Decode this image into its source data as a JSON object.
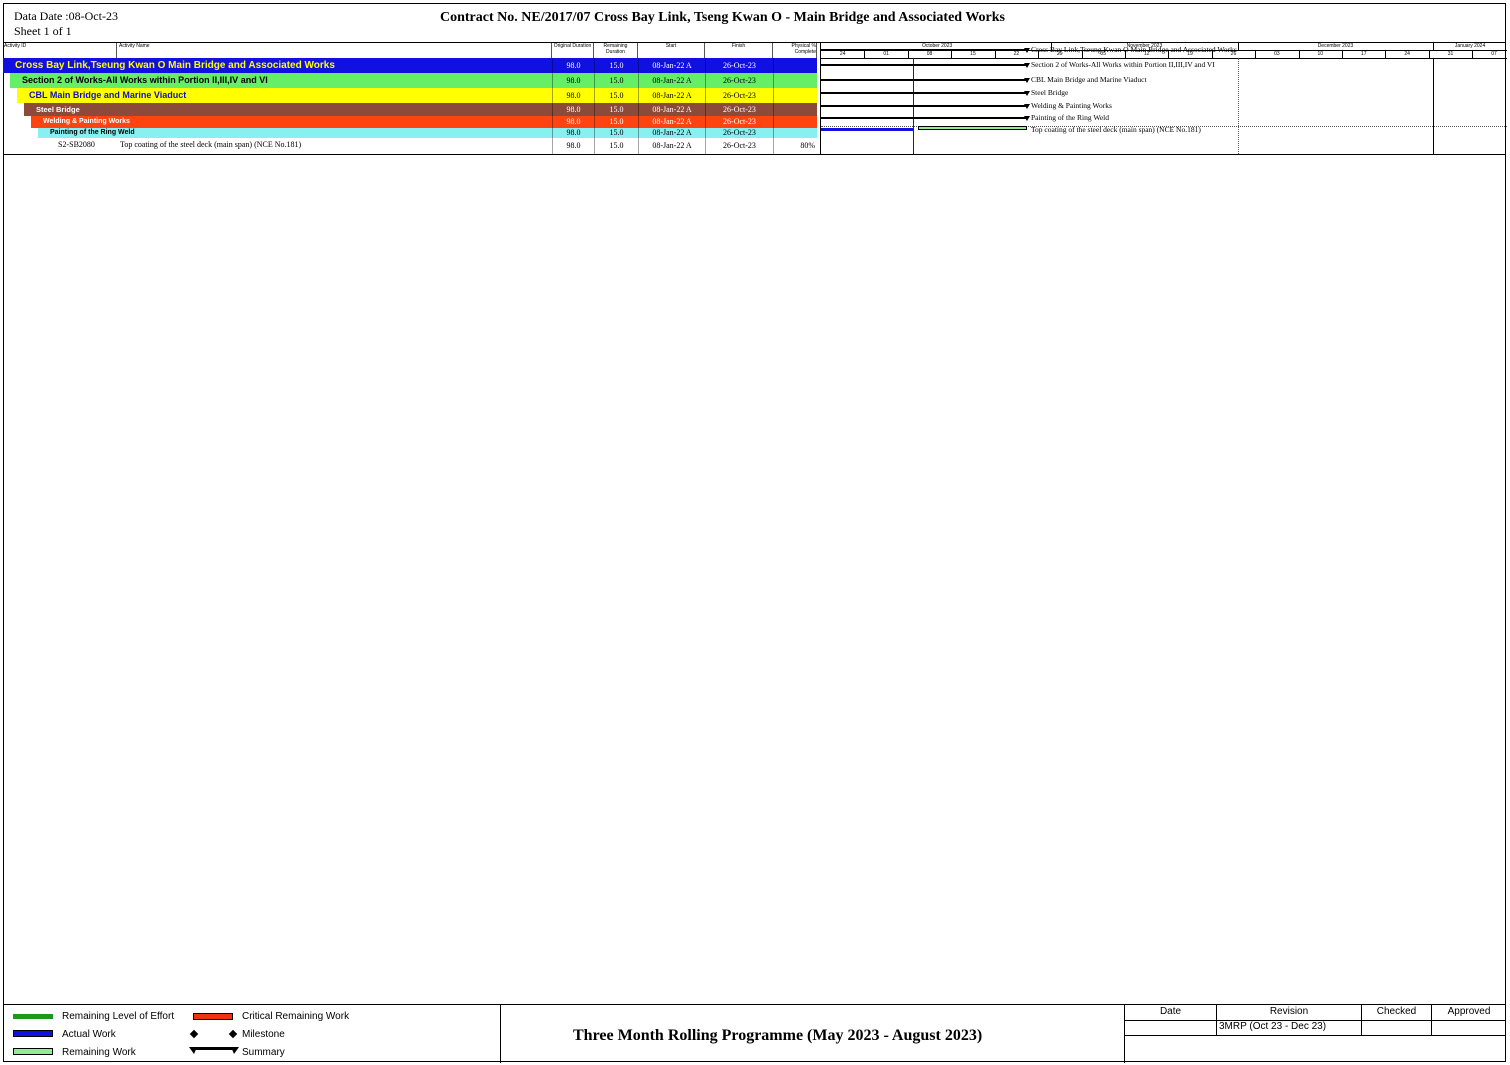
{
  "header": {
    "data_date": "Data Date :08-Oct-23",
    "sheet": "Sheet 1 of 1",
    "title": "Contract  No. NE/2017/07  Cross Bay Link, Tseng Kwan O - Main Bridge and Associated Works"
  },
  "columns": {
    "activity_id": "Activity ID",
    "activity_name": "Activity Name",
    "original_duration": "Original Duration",
    "remaining_duration": "Remaining Duration",
    "start": "Start",
    "finish": "Finish",
    "physical_complete": "Physical % Complete"
  },
  "timescale": {
    "months": [
      "October 2023",
      "November 2023",
      "December 2023",
      "January 2024"
    ],
    "weeks": [
      "24",
      "01",
      "08",
      "15",
      "22",
      "29",
      "05",
      "12",
      "19",
      "26",
      "03",
      "10",
      "17",
      "24",
      "31",
      "07"
    ]
  },
  "rows": [
    {
      "id": "",
      "name": "Cross Bay Link,Tseung Kwan O Main Bridge and Associated Works",
      "orig": "98.0",
      "rem": "15.0",
      "start": "08-Jan-22 A",
      "finish": "26-Oct-23",
      "pct": "",
      "bar_label": "Cross Bay Link,Tseung Kwan O Main Bridge and Associated Works",
      "color": "#1010e0",
      "text_color": "#ffff00"
    },
    {
      "id": "",
      "name": "Section 2 of Works-All Works within Portion II,III,IV and VI",
      "orig": "98.0",
      "rem": "15.0",
      "start": "08-Jan-22 A",
      "finish": "26-Oct-23",
      "pct": "",
      "bar_label": "Section 2 of Works-All Works within Portion II,III,IV and VI",
      "color": "#66ee66",
      "text_color": "#000000"
    },
    {
      "id": "",
      "name": "CBL Main Bridge and Marine Viaduct",
      "orig": "98.0",
      "rem": "15.0",
      "start": "08-Jan-22 A",
      "finish": "26-Oct-23",
      "pct": "",
      "bar_label": "CBL Main Bridge and Marine Viaduct",
      "color": "#ffff00",
      "text_color": "#1010c0"
    },
    {
      "id": "",
      "name": "Steel Bridge",
      "orig": "98.0",
      "rem": "15.0",
      "start": "08-Jan-22 A",
      "finish": "26-Oct-23",
      "pct": "",
      "bar_label": "Steel Bridge",
      "color": "#8b4a3a",
      "text_color": "#ffffff"
    },
    {
      "id": "",
      "name": "Welding & Painting Works",
      "orig": "98.0",
      "rem": "15.0",
      "start": "08-Jan-22 A",
      "finish": "26-Oct-23",
      "pct": "",
      "bar_label": "Welding & Painting Works",
      "color": "#ff4411",
      "text_color": "#ffffff"
    },
    {
      "id": "",
      "name": "Painting of the Ring Weld",
      "orig": "98.0",
      "rem": "15.0",
      "start": "08-Jan-22 A",
      "finish": "26-Oct-23",
      "pct": "",
      "bar_label": "Painting of the Ring Weld",
      "color": "#88f0f0",
      "text_color": "#000000"
    },
    {
      "id": "S2-SB2080",
      "name": "Top coating of the steel deck (main span) (NCE No.181)",
      "orig": "98.0",
      "rem": "15.0",
      "start": "08-Jan-22 A",
      "finish": "26-Oct-23",
      "pct": "80%",
      "bar_label": "Top coating of the steel deck (main span) (NCE No.181)",
      "color": "#ffffff",
      "text_color": "#000000"
    }
  ],
  "legend": {
    "remaining_loe": "Remaining Level of Effort",
    "actual_work": "Actual Work",
    "remaining_work": "Remaining Work",
    "critical_remaining": "Critical Remaining Work",
    "milestone": "Milestone",
    "summary": "Summary"
  },
  "footer": {
    "title": "Three Month Rolling Programme (May 2023 - August 2023)",
    "rev_headers": {
      "date": "Date",
      "revision": "Revision",
      "checked": "Checked",
      "approved": "Approved"
    },
    "rev_row": {
      "date": "",
      "revision": "3MRP (Oct 23 - Dec 23)",
      "checked": "",
      "approved": ""
    }
  },
  "colors": {
    "actual_work": "#1010e0",
    "remaining_work": "#90ee90",
    "remaining_loe": "#1a9a1a",
    "critical_remaining": "#ee3311"
  }
}
